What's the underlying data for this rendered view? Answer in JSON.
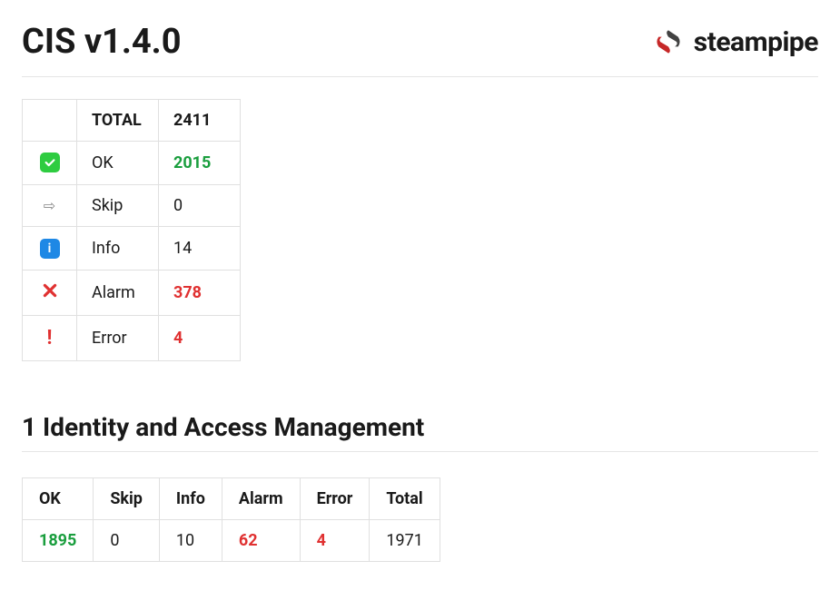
{
  "header": {
    "title": "CIS v1.4.0",
    "brand": "steampipe"
  },
  "summary": {
    "header": {
      "label": "TOTAL",
      "value": "2411"
    },
    "rows": {
      "ok": {
        "label": "OK",
        "value": "2015"
      },
      "skip": {
        "label": "Skip",
        "value": "0"
      },
      "info": {
        "label": "Info",
        "value": "14"
      },
      "alarm": {
        "label": "Alarm",
        "value": "378"
      },
      "error": {
        "label": "Error",
        "value": "4"
      }
    }
  },
  "section": {
    "title": "1 Identity and Access Management",
    "headers": {
      "ok": "OK",
      "skip": "Skip",
      "info": "Info",
      "alarm": "Alarm",
      "error": "Error",
      "total": "Total"
    },
    "row": {
      "ok": "1895",
      "skip": "0",
      "info": "10",
      "alarm": "62",
      "error": "4",
      "total": "1971"
    }
  }
}
